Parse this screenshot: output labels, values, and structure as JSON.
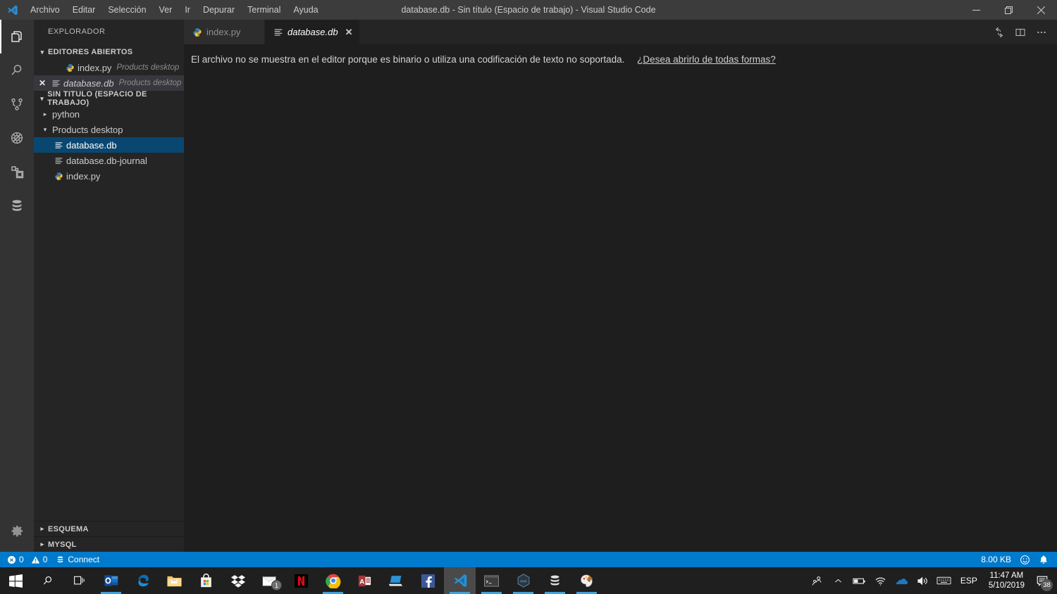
{
  "window": {
    "title": "database.db - Sin título (Espacio de trabajo) - Visual Studio Code",
    "minimize_label": "Minimizar",
    "restore_label": "Restaurar",
    "close_label": "Cerrar"
  },
  "menu": {
    "items": [
      {
        "label": "Archivo",
        "name": "menu-archivo"
      },
      {
        "label": "Editar",
        "name": "menu-editar"
      },
      {
        "label": "Selección",
        "name": "menu-seleccion"
      },
      {
        "label": "Ver",
        "name": "menu-ver"
      },
      {
        "label": "Ir",
        "name": "menu-ir"
      },
      {
        "label": "Depurar",
        "name": "menu-depurar"
      },
      {
        "label": "Terminal",
        "name": "menu-terminal"
      },
      {
        "label": "Ayuda",
        "name": "menu-ayuda"
      }
    ]
  },
  "activitybar": {
    "items": [
      {
        "icon": "files-explorer-icon",
        "label": "Explorador",
        "active": true
      },
      {
        "icon": "search-icon",
        "label": "Buscar",
        "active": false
      },
      {
        "icon": "source-control-icon",
        "label": "Control de código fuente",
        "active": false
      },
      {
        "icon": "debug-no-icon",
        "label": "Depurar",
        "active": false
      },
      {
        "icon": "extensions-icon",
        "label": "Extensiones",
        "active": false
      },
      {
        "icon": "database-icon",
        "label": "Base de datos",
        "active": false
      }
    ],
    "settings_label": "Administrar"
  },
  "sidebar": {
    "title": "EXPLORADOR",
    "open_editors": {
      "header": "EDITORES ABIERTOS",
      "expanded": true,
      "items": [
        {
          "name": "index.py",
          "description": "Products desktop",
          "icon": "python-icon",
          "active": false,
          "italic": false
        },
        {
          "name": "database.db",
          "description": "Products desktop",
          "icon": "db-lines-icon",
          "active": true,
          "italic": true
        }
      ]
    },
    "workspace": {
      "header": "SIN TÍTULO (ESPACIO DE TRABAJO)",
      "expanded": true,
      "folders": [
        {
          "name": "python",
          "expanded": false,
          "type": "folder"
        },
        {
          "name": "Products desktop",
          "expanded": true,
          "type": "folder"
        }
      ],
      "files": [
        {
          "name": "database.db",
          "icon": "db-lines-icon",
          "selected": true
        },
        {
          "name": "database.db-journal",
          "icon": "db-lines-icon",
          "selected": false
        },
        {
          "name": "index.py",
          "icon": "python-icon",
          "selected": false
        }
      ]
    },
    "bottom_sections": [
      {
        "label": "ESQUEMA",
        "expanded": false
      },
      {
        "label": "MYSQL",
        "expanded": false
      }
    ]
  },
  "editor": {
    "tabs": [
      {
        "label": "index.py",
        "icon": "python-icon",
        "active": false,
        "italic": false,
        "closable": false
      },
      {
        "label": "database.db",
        "icon": "db-lines-icon",
        "active": true,
        "italic": true,
        "closable": true
      }
    ],
    "actions": [
      {
        "icon": "refresh-icon",
        "label": "Actualizar"
      },
      {
        "icon": "split-editor-icon",
        "label": "Dividir editor"
      },
      {
        "icon": "more-actions-icon",
        "label": "Más acciones..."
      }
    ],
    "binary_message": "El archivo no se muestra en el editor porque es binario o utiliza una codificación de texto no soportada.",
    "binary_link": "¿Desea abrirlo de todas formas?"
  },
  "statusbar": {
    "errors": "0",
    "warnings": "0",
    "connect_label": "Connect",
    "file_size": "8.00 KB",
    "feedback_icon": "smiley-icon",
    "notifications_icon": "bell-icon",
    "accent_color": "#007acc"
  },
  "taskbar": {
    "buttons": [
      {
        "name": "start-button",
        "icon": "windows-logo-icon",
        "label": "Inicio",
        "running": false,
        "active": false,
        "badge": null
      },
      {
        "name": "search-button",
        "icon": "search-icon",
        "label": "Buscar",
        "running": false,
        "active": false,
        "badge": null
      },
      {
        "name": "task-view-button",
        "icon": "task-view-icon",
        "label": "Vista de tareas",
        "running": false,
        "active": false,
        "badge": null
      },
      {
        "name": "outlook-button",
        "icon": "outlook-icon",
        "label": "Outlook",
        "running": true,
        "active": false,
        "badge": null
      },
      {
        "name": "edge-button",
        "icon": "edge-icon",
        "label": "Microsoft Edge",
        "running": false,
        "active": false,
        "badge": null
      },
      {
        "name": "file-explorer-button",
        "icon": "folder-icon",
        "label": "Explorador de archivos",
        "running": false,
        "active": false,
        "badge": null
      },
      {
        "name": "store-button",
        "icon": "store-icon",
        "label": "Microsoft Store",
        "running": false,
        "active": false,
        "badge": null
      },
      {
        "name": "dropbox-button",
        "icon": "dropbox-icon",
        "label": "Dropbox",
        "running": false,
        "active": false,
        "badge": null
      },
      {
        "name": "mail-button",
        "icon": "mail-icon",
        "label": "Correo",
        "running": false,
        "active": false,
        "badge": "1"
      },
      {
        "name": "netflix-button",
        "icon": "netflix-icon",
        "label": "Netflix",
        "running": false,
        "active": false,
        "badge": null
      },
      {
        "name": "chrome-button",
        "icon": "chrome-icon",
        "label": "Google Chrome",
        "running": true,
        "active": false,
        "badge": null
      },
      {
        "name": "access-button",
        "icon": "access-icon",
        "label": "Access",
        "running": false,
        "active": false,
        "badge": null
      },
      {
        "name": "remote-desktop-button",
        "icon": "remote-desktop-icon",
        "label": "Escritorio remoto",
        "running": false,
        "active": false,
        "badge": null
      },
      {
        "name": "facebook-button",
        "icon": "facebook-icon",
        "label": "Facebook",
        "running": false,
        "active": false,
        "badge": null
      },
      {
        "name": "vscode-button",
        "icon": "vscode-icon",
        "label": "Visual Studio Code",
        "running": true,
        "active": true,
        "badge": null
      },
      {
        "name": "terminal-button",
        "icon": "terminal-icon",
        "label": "Consola",
        "running": true,
        "active": false,
        "badge": null
      },
      {
        "name": "nox-button",
        "icon": "nox-icon",
        "label": "Nox",
        "running": true,
        "active": false,
        "badge": null
      },
      {
        "name": "mysql-workbench-button",
        "icon": "database-icon",
        "label": "MySQL Workbench",
        "running": true,
        "active": false,
        "badge": null
      },
      {
        "name": "paint-button",
        "icon": "paint-icon",
        "label": "Paint 3D",
        "running": true,
        "active": false,
        "badge": null
      }
    ],
    "tray": {
      "icons": [
        {
          "name": "people-icon",
          "label": "Mis contactos"
        },
        {
          "name": "chevron-up-icon",
          "label": "Mostrar iconos ocultos"
        },
        {
          "name": "battery-icon",
          "label": "Batería"
        },
        {
          "name": "wifi-icon",
          "label": "Red"
        },
        {
          "name": "onedrive-icon",
          "label": "OneDrive"
        },
        {
          "name": "volume-icon",
          "label": "Volumen"
        },
        {
          "name": "keyboard-icon",
          "label": "Teclado táctil"
        }
      ],
      "language": "ESP",
      "time": "11:47 AM",
      "date": "5/10/2019",
      "notifications_count": "38"
    }
  }
}
